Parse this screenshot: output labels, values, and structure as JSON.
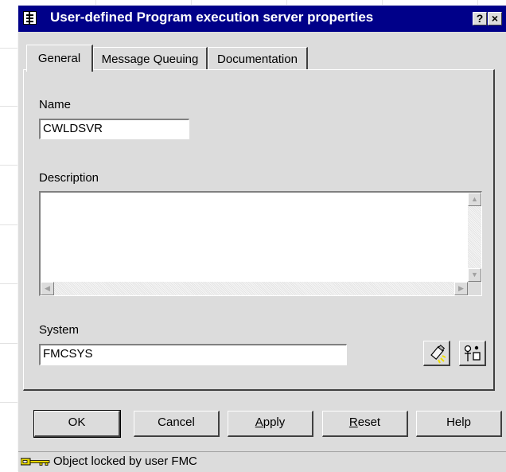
{
  "window": {
    "title": "User-defined Program execution server properties",
    "help_label": "?",
    "close_label": "×"
  },
  "tabs": [
    {
      "label": "General",
      "active": true
    },
    {
      "label": "Message Queuing",
      "active": false
    },
    {
      "label": "Documentation",
      "active": false
    }
  ],
  "form": {
    "name_label": "Name",
    "name_value": "CWLDSVR",
    "description_label": "Description",
    "description_value": "",
    "system_label": "System",
    "system_value": "FMCSYS"
  },
  "buttons": {
    "ok": "OK",
    "cancel": "Cancel",
    "apply_mnemonic": "A",
    "apply_rest": "pply",
    "reset_mnemonic": "R",
    "reset_rest": "eset",
    "help": "Help"
  },
  "status": {
    "text": "Object locked by user FMC",
    "icon": "key-icon"
  },
  "icons": {
    "find": "flashlight-icon",
    "tree": "hierarchy-icon"
  },
  "colors": {
    "titlebar": "#000089",
    "face": "#dcdcdc",
    "key": "#e8d800"
  }
}
